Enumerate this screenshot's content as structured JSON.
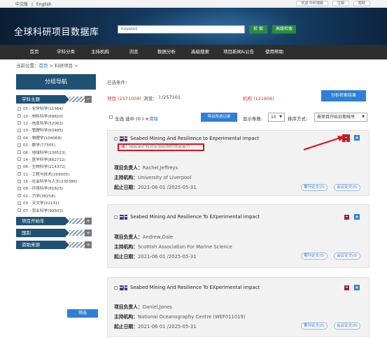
{
  "topbar": {
    "lang_zh": "中文版",
    "lang_sep": "|",
    "lang_en": "English",
    "links": [
      "欢迎 中科馆服",
      "注销",
      "帮助"
    ]
  },
  "header": {
    "site_title": "全球科研项目数据库",
    "search_placeholder": "Keyword",
    "search_button": "检 索",
    "advanced_button": "高级检索"
  },
  "nav": {
    "items": [
      "首页",
      "学科分类",
      "主持机构",
      "浏览",
      "数据分析",
      "高级搜索",
      "项目新闻&公告",
      "使用帮助"
    ]
  },
  "breadcrumb": {
    "prefix": "当前位置：",
    "home": "首页",
    "current": " > 科研项目 >"
  },
  "sidebar": {
    "title": "分组导航",
    "subject_header": "学科主题",
    "subjects": [
      "05 - 化学科学(11564)",
      "10 - 材料科学(69820)",
      "12 - 信息科学(52063)",
      "13 - 管理科学(63485)",
      "04 - 物理学(104068)",
      "01 - 数学(77305)",
      "08 - 地球科学(136523)",
      "14 - 医学科学(882712)",
      "06 - 生物科学(214372)",
      "11 - 工程与技术(299005)",
      "15 - 社会科学与人文(230386)",
      "09 - 环境科学(81823)",
      "02 - 力学(38258)",
      "03 - 天文学(02131)",
      "07 - 农业科学(99503)"
    ],
    "sections": [
      "项目开始年",
      "国别",
      "资助来源"
    ],
    "toggle_minus": "−",
    "toggle_plus": "+",
    "filter_button": "筛选"
  },
  "main": {
    "selected_label": "已选条件：",
    "stats": {
      "projects": "项目 (2571009)",
      "browse_label": "浏览：",
      "page_current": "1",
      "page_total": "/257101",
      "institutions": "机构 (121806)"
    },
    "analyze_button": "分析检索结果",
    "toolbar": {
      "select_all": "全选",
      "selected_prefix": "选中 (",
      "selected_count": "0",
      "selected_suffix": " )",
      "clear": "清除",
      "export_button": "导出所选记录",
      "display_label": "显示条数:",
      "display_value": "10",
      "sort_label": "排序方式:",
      "sort_value": "按项目开始日期排序"
    },
    "records": [
      {
        "title": "Seabed Mining And Resilience to Experimental impact",
        "translation_label": "译：",
        "translation": "海底采矿和对实验影响的恢复能力",
        "leader_label": "项目负责人：",
        "leader": "Rachel,Jeffreys",
        "inst_label": "主持机构：",
        "inst": "University of Liverpool",
        "date_label": "起止日期：",
        "dates": "2021-06-01 /2025-05-31",
        "journal_btn": "期刊论文(0)",
        "conf_btn": "会议论文(0)"
      },
      {
        "title": "Seabed Mining And Resilience To EXperimental impact",
        "leader_label": "项目负责人：",
        "leader": "Andrew,Dale",
        "inst_label": "主持机构：",
        "inst": "Scottish Association For Marine Science",
        "date_label": "起止日期：",
        "dates": "2021-06-01 /2025-05-31",
        "journal_btn": "期刊论文(0)",
        "conf_btn": "会议论文(0)"
      },
      {
        "title": "Seabed Mining And Resilience To EXperimental impact",
        "leader_label": "项目负责人：",
        "leader": "Daniel,Jones",
        "inst_label": "主持机构：",
        "inst": "National Oceanography Centre (WEF011019)",
        "date_label": "起止日期：",
        "dates": "2021-06-01 /2025-05-31",
        "journal_btn": "期刊论文(0)",
        "conf_btn": "会议论文(0)"
      }
    ],
    "add_icon": "+"
  },
  "colors": {
    "accent": "#2e7fd5",
    "sidebar": "#1f5173",
    "highlight": "#d8141b",
    "search_green": "#2b8a3e"
  },
  "icons": [
    "uk-flag-icon",
    "translate-icon",
    "add-icon",
    "arrow-annotation"
  ]
}
